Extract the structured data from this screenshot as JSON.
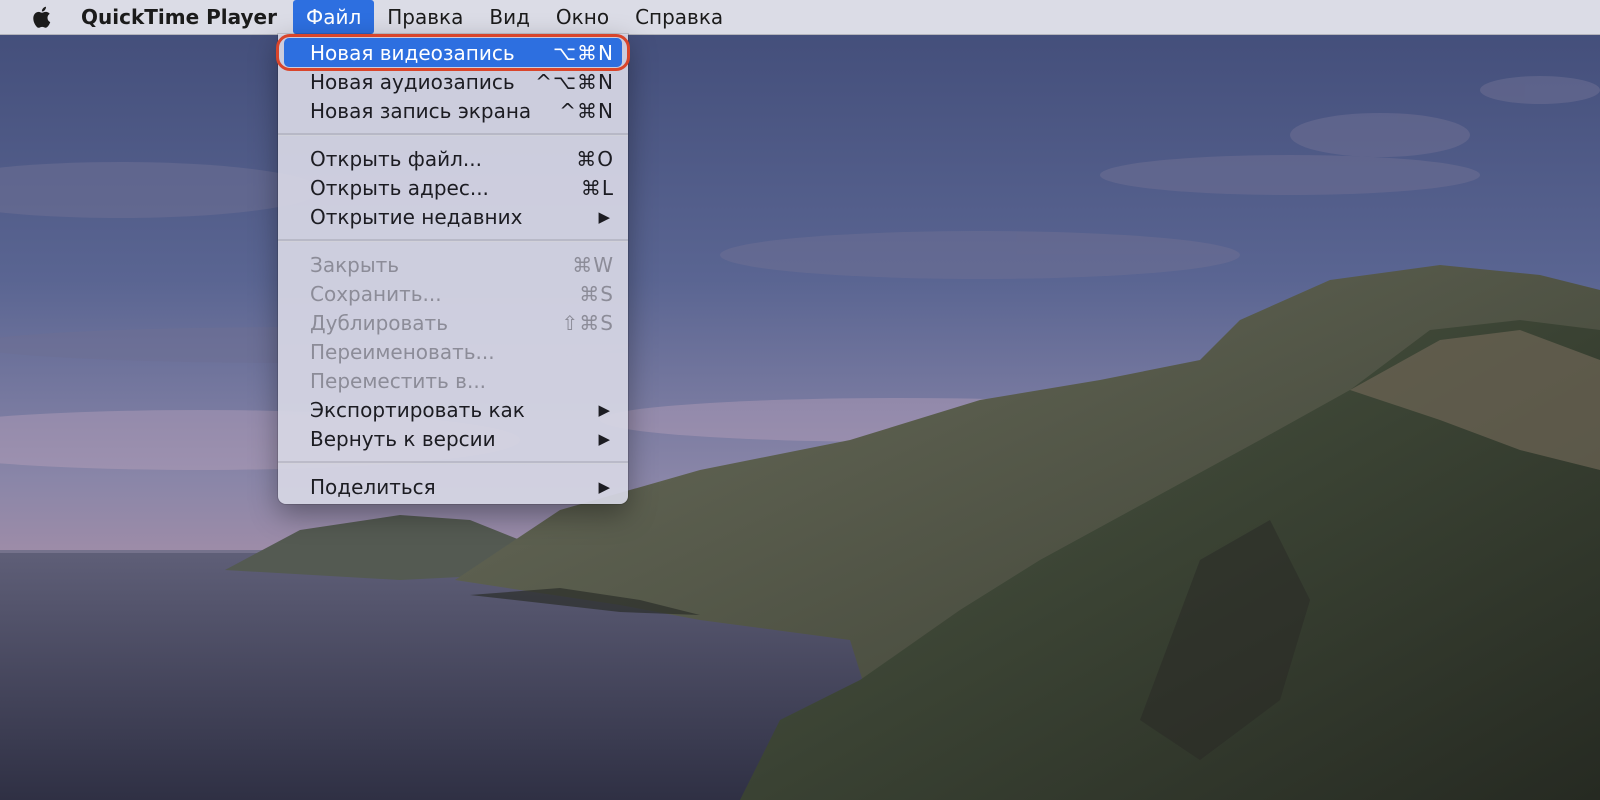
{
  "menubar": {
    "app_name": "QuickTime Player",
    "items": [
      {
        "label": "Файл",
        "active": true
      },
      {
        "label": "Правка"
      },
      {
        "label": "Вид"
      },
      {
        "label": "Окно"
      },
      {
        "label": "Справка"
      }
    ]
  },
  "file_menu": {
    "groups": [
      [
        {
          "label": "Новая видеозапись",
          "shortcut": "⌥⌘N",
          "state": "highlighted"
        },
        {
          "label": "Новая аудиозапись",
          "shortcut": "^⌥⌘N"
        },
        {
          "label": "Новая запись экрана",
          "shortcut": "^⌘N"
        }
      ],
      [
        {
          "label": "Открыть файл...",
          "shortcut": "⌘O"
        },
        {
          "label": "Открыть адрес...",
          "shortcut": "⌘L"
        },
        {
          "label": "Открытие недавних",
          "shortcut": "▶"
        }
      ],
      [
        {
          "label": "Закрыть",
          "shortcut": "⌘W",
          "state": "disabled"
        },
        {
          "label": "Сохранить...",
          "shortcut": "⌘S",
          "state": "disabled"
        },
        {
          "label": "Дублировать",
          "shortcut": "⇧⌘S",
          "state": "disabled"
        },
        {
          "label": "Переименовать...",
          "state": "disabled"
        },
        {
          "label": "Переместить в...",
          "state": "disabled"
        },
        {
          "label": "Экспортировать как",
          "shortcut": "▶"
        },
        {
          "label": "Вернуть к версии",
          "shortcut": "▶"
        }
      ],
      [
        {
          "label": "Поделиться",
          "shortcut": "▶"
        }
      ]
    ]
  },
  "colors": {
    "highlight": "#2d6fe0",
    "annotation_ring": "#d9452b",
    "menubar_bg": "#e2e2ea",
    "menu_bg": "#d6d6e4"
  },
  "icons": {
    "apple": "apple-logo-icon",
    "submenu": "chevron-right-icon"
  }
}
